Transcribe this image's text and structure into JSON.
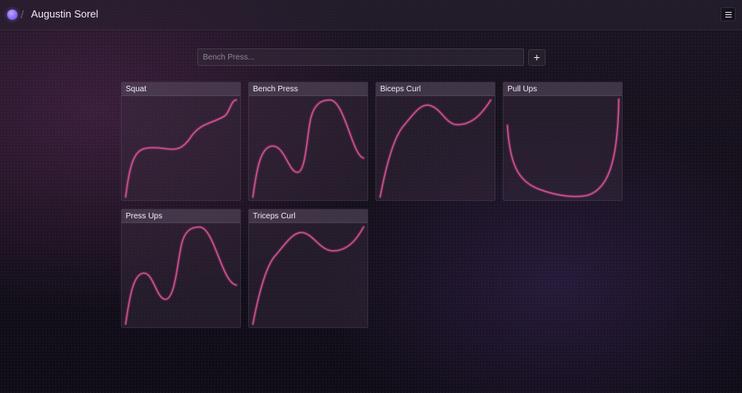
{
  "header": {
    "separator": "/",
    "user_name": "Augustin Sorel",
    "avatar_icon": "avatar-orb",
    "menu_icon": "hamburger-icon"
  },
  "search": {
    "placeholder": "Bench Press...",
    "value": "",
    "add_label": "+"
  },
  "colors": {
    "accent_curve": "#e0579a",
    "avatar": "#8b6df5"
  },
  "exercises": [
    {
      "name": "Squat"
    },
    {
      "name": "Bench Press"
    },
    {
      "name": "Biceps Curl"
    },
    {
      "name": "Pull Ups"
    },
    {
      "name": "Press Ups"
    },
    {
      "name": "Triceps Curl"
    }
  ]
}
